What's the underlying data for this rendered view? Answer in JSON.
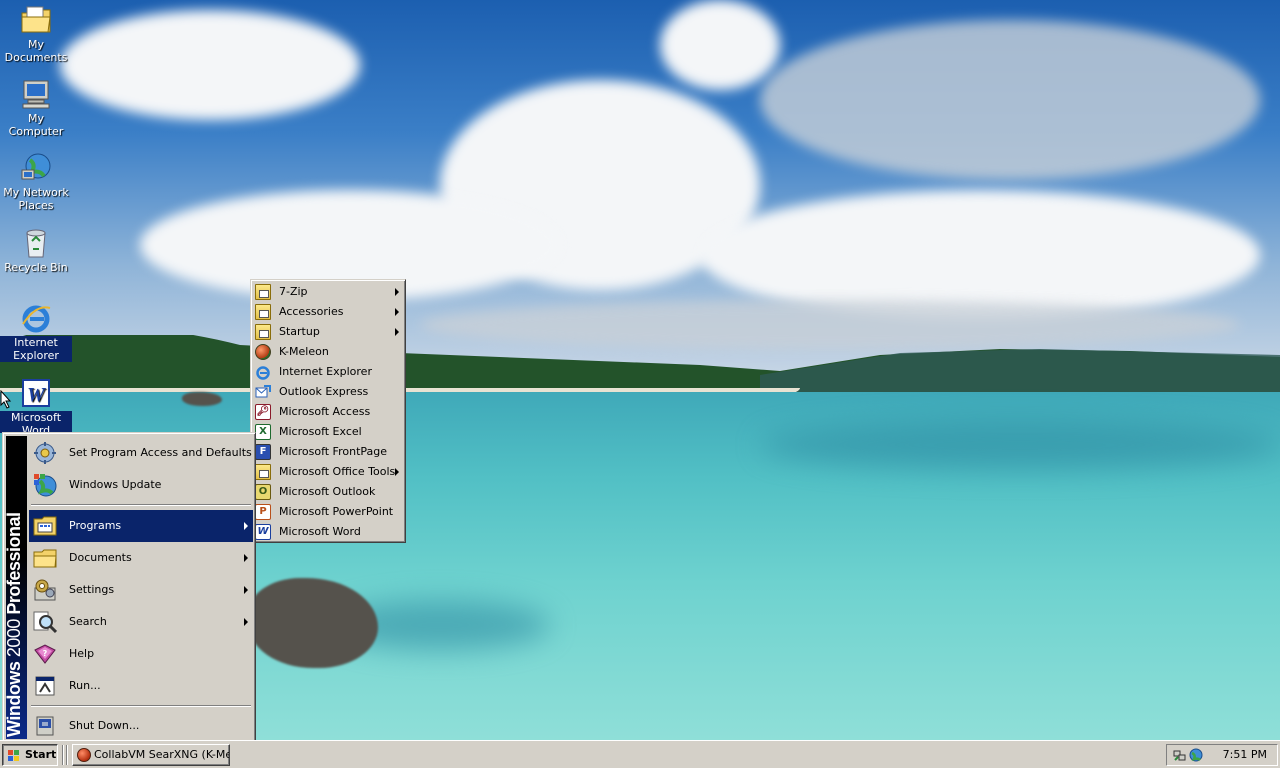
{
  "desktop": {
    "icons": [
      {
        "label": "My Documents",
        "icon": "my-documents-icon"
      },
      {
        "label": "My Computer",
        "icon": "my-computer-icon"
      },
      {
        "label": "My Network Places",
        "icon": "network-places-icon"
      },
      {
        "label": "Recycle Bin",
        "icon": "recycle-bin-icon"
      },
      {
        "label": "Internet Explorer",
        "icon": "internet-explorer-icon"
      },
      {
        "label": "Microsoft Word",
        "icon": "microsoft-word-icon"
      }
    ]
  },
  "start_menu": {
    "banner": {
      "brand": "Windows",
      "version": "2000",
      "edition": "Professional"
    },
    "items": [
      {
        "label": "Set Program Access and Defaults",
        "icon": "program-access-icon",
        "submenu": false
      },
      {
        "label": "Windows Update",
        "icon": "windows-update-icon",
        "submenu": false
      },
      {
        "label": "Programs",
        "icon": "programs-icon",
        "submenu": true,
        "highlighted": true
      },
      {
        "label": "Documents",
        "icon": "documents-icon",
        "submenu": true
      },
      {
        "label": "Settings",
        "icon": "settings-icon",
        "submenu": true
      },
      {
        "label": "Search",
        "icon": "search-icon",
        "submenu": true
      },
      {
        "label": "Help",
        "icon": "help-icon",
        "submenu": false
      },
      {
        "label": "Run...",
        "icon": "run-icon",
        "submenu": false
      },
      {
        "label": "Shut Down...",
        "icon": "shut-down-icon",
        "submenu": false
      }
    ]
  },
  "programs_menu": {
    "items": [
      {
        "label": "7-Zip",
        "icon": "folder-icon",
        "submenu": true
      },
      {
        "label": "Accessories",
        "icon": "folder-icon",
        "submenu": true
      },
      {
        "label": "Startup",
        "icon": "folder-icon",
        "submenu": true
      },
      {
        "label": "K-Meleon",
        "icon": "k-meleon-icon",
        "submenu": false
      },
      {
        "label": "Internet Explorer",
        "icon": "internet-explorer-icon",
        "submenu": false
      },
      {
        "label": "Outlook Express",
        "icon": "outlook-express-icon",
        "submenu": false
      },
      {
        "label": "Microsoft Access",
        "icon": "microsoft-access-icon",
        "submenu": false
      },
      {
        "label": "Microsoft Excel",
        "icon": "microsoft-excel-icon",
        "submenu": false
      },
      {
        "label": "Microsoft FrontPage",
        "icon": "microsoft-frontpage-icon",
        "submenu": false
      },
      {
        "label": "Microsoft Office Tools",
        "icon": "folder-icon",
        "submenu": true
      },
      {
        "label": "Microsoft Outlook",
        "icon": "microsoft-outlook-icon",
        "submenu": false
      },
      {
        "label": "Microsoft PowerPoint",
        "icon": "microsoft-powerpoint-icon",
        "submenu": false
      },
      {
        "label": "Microsoft Word",
        "icon": "microsoft-word-icon",
        "submenu": false
      }
    ]
  },
  "taskbar": {
    "start_label": "Start",
    "tasks": [
      {
        "label": "CollabVM SearXNG (K-Mel...",
        "icon": "k-meleon-icon"
      }
    ],
    "clock": "7:51 PM"
  },
  "colors": {
    "highlight": "#0a246a",
    "face": "#d4d0c8",
    "desktop_sky": "#2a6fb8"
  }
}
